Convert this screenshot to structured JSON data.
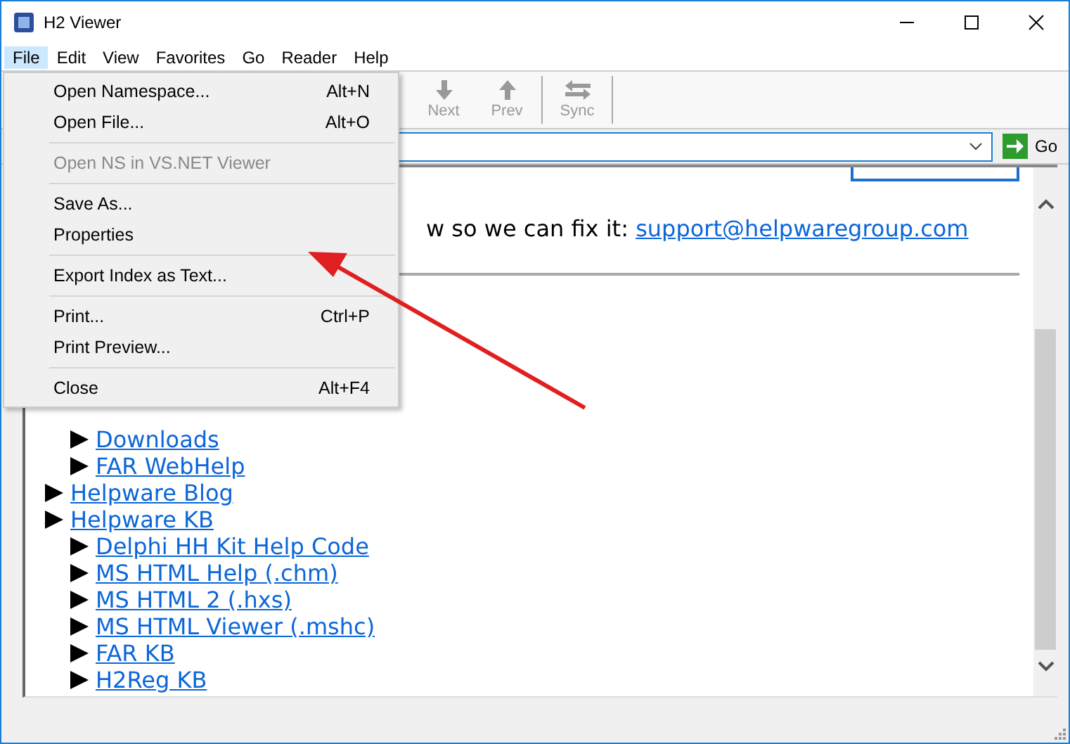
{
  "window": {
    "title": "H2 Viewer"
  },
  "menu_bar": [
    {
      "label": "File",
      "selected": true
    },
    {
      "label": "Edit",
      "selected": false
    },
    {
      "label": "View",
      "selected": false
    },
    {
      "label": "Favorites",
      "selected": false
    },
    {
      "label": "Go",
      "selected": false
    },
    {
      "label": "Reader",
      "selected": false
    },
    {
      "label": "Help",
      "selected": false
    }
  ],
  "toolbar": [
    {
      "label": "Next",
      "kind": "down",
      "disabled": true
    },
    {
      "label": "Prev",
      "kind": "up",
      "disabled": true
    },
    {
      "label": "Sync",
      "kind": "sync",
      "disabled": true
    }
  ],
  "address_bar": {
    "go_label": "Go"
  },
  "content": {
    "sentence": "w so we can fix it: ",
    "link": "support@helpwaregroup.com",
    "tree": [
      {
        "children": [
          {
            "label": "Downloads"
          },
          {
            "label": "FAR WebHelp"
          }
        ]
      },
      {
        "label": "Helpware Blog"
      },
      {
        "label": "Helpware KB",
        "children": [
          {
            "label": "Delphi HH Kit Help Code"
          },
          {
            "label": "MS HTML Help (.chm)"
          },
          {
            "label": "MS HTML 2 (.hxs)"
          },
          {
            "label": "MS HTML Viewer (.mshc)"
          },
          {
            "label": "FAR KB"
          },
          {
            "label": "H2Reg KB"
          }
        ]
      }
    ]
  },
  "file_menu": [
    [
      {
        "label": "Open Namespace...",
        "shortcut": "Alt+N",
        "disabled": false
      },
      {
        "label": "Open File...",
        "shortcut": "Alt+O",
        "disabled": false
      }
    ],
    [
      {
        "label": "Open NS in VS.NET Viewer",
        "disabled": true
      }
    ],
    [
      {
        "label": "Save As...",
        "disabled": false
      },
      {
        "label": "Properties",
        "disabled": false
      }
    ],
    [
      {
        "label": "Export Index as Text...",
        "disabled": false
      }
    ],
    [
      {
        "label": "Print...",
        "shortcut": "Ctrl+P",
        "disabled": false
      },
      {
        "label": "Print Preview...",
        "disabled": false
      }
    ],
    [
      {
        "label": "Close",
        "shortcut": "Alt+F4",
        "disabled": false
      }
    ]
  ]
}
